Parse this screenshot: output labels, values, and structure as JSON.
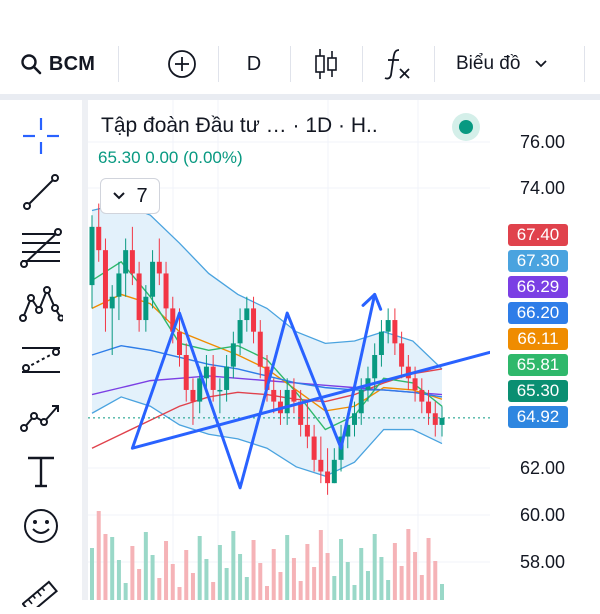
{
  "toolbar": {
    "symbol": "BCM",
    "interval": "D",
    "chart_type_label": "Biểu đồ"
  },
  "sidebar": {
    "tools": [
      "crosshair-icon",
      "trend-line-icon",
      "fib-retracement-icon",
      "pattern-icon",
      "forecast-icon",
      "brush-icon",
      "text-icon",
      "emoji-icon",
      "ruler-icon"
    ]
  },
  "legend": {
    "title": "Tập đoàn Đầu tư …  · 1D · H..",
    "price": "65.30",
    "change": "0.00",
    "change_pct": "(0.00%)",
    "indicator_count": "7"
  },
  "price_scale": {
    "ticks": [
      "76.00",
      "74.00",
      "62.00",
      "60.00",
      "58.00"
    ],
    "badges": [
      {
        "label": "67.40",
        "color": "#e0424c"
      },
      {
        "label": "67.30",
        "color": "#4aa3df"
      },
      {
        "label": "66.29",
        "color": "#7b3fe4"
      },
      {
        "label": "66.20",
        "color": "#2e7de8"
      },
      {
        "label": "66.11",
        "color": "#ef8c00"
      },
      {
        "label": "65.81",
        "color": "#2fb86b"
      },
      {
        "label": "65.30",
        "color": "#0a8f72"
      },
      {
        "label": "64.92",
        "color": "#2e86e0"
      }
    ]
  },
  "chart_data": {
    "type": "candlestick",
    "ylim": [
      57,
      78
    ],
    "candles": [
      [
        71,
        74,
        70,
        73.5
      ],
      [
        73.5,
        74.5,
        72,
        72.5
      ],
      [
        72.5,
        73,
        69,
        70
      ],
      [
        70,
        71,
        68,
        70.5
      ],
      [
        70.5,
        72,
        69.5,
        71.5
      ],
      [
        71.5,
        73,
        70.5,
        72.5
      ],
      [
        72.5,
        73.5,
        71,
        71.5
      ],
      [
        71.5,
        72,
        69,
        69.5
      ],
      [
        69.5,
        71,
        69,
        70.5
      ],
      [
        70.5,
        72.5,
        70,
        72
      ],
      [
        72,
        73,
        71,
        71.5
      ],
      [
        71.5,
        72,
        69.5,
        70
      ],
      [
        70,
        70.5,
        68.5,
        69
      ],
      [
        69,
        70,
        67.5,
        68
      ],
      [
        68,
        68.5,
        66,
        66.5
      ],
      [
        66.5,
        67,
        65,
        66
      ],
      [
        66,
        67.5,
        65.5,
        67
      ],
      [
        67,
        68,
        66.5,
        67.5
      ],
      [
        67.5,
        68,
        66,
        66.5
      ],
      [
        66.5,
        67,
        65.5,
        66.5
      ],
      [
        66.5,
        68,
        66,
        67.5
      ],
      [
        67.5,
        69,
        67,
        68.5
      ],
      [
        68.5,
        70,
        68,
        69.5
      ],
      [
        69.5,
        70.5,
        69,
        70
      ],
      [
        70,
        70.5,
        68.5,
        69
      ],
      [
        69,
        69.5,
        67,
        67.5
      ],
      [
        67.5,
        68,
        66,
        66.5
      ],
      [
        66.5,
        67,
        65.5,
        66
      ],
      [
        66,
        66.5,
        65,
        65.5
      ],
      [
        65.5,
        67,
        65,
        66.5
      ],
      [
        66.5,
        67,
        65.5,
        66
      ],
      [
        66,
        66.5,
        64.5,
        65
      ],
      [
        65,
        66,
        64,
        64.5
      ],
      [
        64.5,
        65,
        63,
        63.5
      ],
      [
        63.5,
        64.5,
        62.5,
        63
      ],
      [
        63,
        64,
        62,
        62.5
      ],
      [
        62.5,
        64,
        62.5,
        63.5
      ],
      [
        63.5,
        65,
        63,
        64.5
      ],
      [
        64.5,
        65.5,
        64,
        65
      ],
      [
        65,
        66,
        64.5,
        65.5
      ],
      [
        65.5,
        67,
        65,
        66.5
      ],
      [
        66.5,
        67.5,
        66,
        67
      ],
      [
        67,
        68.5,
        66.5,
        68
      ],
      [
        68,
        69.5,
        67.5,
        69
      ],
      [
        69,
        70,
        68.5,
        69.5
      ],
      [
        69.5,
        70,
        68,
        68.5
      ],
      [
        68.5,
        69,
        67,
        67.5
      ],
      [
        67.5,
        68,
        66.5,
        67
      ],
      [
        67,
        67.5,
        66,
        66.5
      ],
      [
        66.5,
        67,
        65.5,
        66
      ],
      [
        66,
        66.5,
        65,
        65.5
      ],
      [
        65.5,
        66,
        64.5,
        65
      ],
      [
        65,
        65.8,
        64.5,
        65.3
      ]
    ],
    "overlays": [
      {
        "name": "",
        "color": "#7b3fe4",
        "values": [
          66.3,
          66.6,
          66.9,
          67.0,
          67.1,
          67.0,
          66.9,
          66.8,
          66.7,
          66.6,
          66.5,
          66.4,
          66.3
        ]
      },
      {
        "name": "",
        "color": "#e0424c",
        "values": [
          64.0,
          64.6,
          65.2,
          65.8,
          66.2,
          66.4,
          66.3,
          66.1,
          66.0,
          66.3,
          66.8,
          67.2,
          67.4
        ]
      },
      {
        "name": "",
        "color": "#ef8c00",
        "values": [
          70.0,
          70.6,
          70.2,
          69.0,
          68.5,
          68.0,
          67.4,
          66.5,
          65.6,
          65.8,
          66.6,
          66.5,
          66.1
        ]
      },
      {
        "name": "",
        "color": "#2fb86b",
        "values": [
          71.2,
          72.0,
          70.5,
          68.5,
          68.2,
          68.4,
          67.8,
          66.4,
          64.8,
          65.4,
          67.0,
          66.8,
          65.8
        ]
      },
      {
        "name": "",
        "color": "#2e7de8",
        "values": [
          68.0,
          68.4,
          68.2,
          67.9,
          67.6,
          67.4,
          67.1,
          66.8,
          66.6,
          66.5,
          66.5,
          66.4,
          66.2
        ]
      }
    ],
    "bands": {
      "upper": [
        74.2,
        74.5,
        74.0,
        72.8,
        71.5,
        70.6,
        70.0,
        69.0,
        68.5,
        68.6,
        69.0,
        68.6,
        67.4
      ],
      "lower": [
        65.5,
        66.2,
        65.8,
        65.0,
        64.6,
        64.4,
        64.0,
        63.2,
        62.8,
        63.4,
        64.8,
        64.8,
        64.2
      ]
    },
    "trend_path": [
      [
        65.4,
        68.6
      ],
      [
        6,
        64.0
      ],
      [
        13,
        69.8
      ],
      [
        22,
        62.3
      ],
      [
        29,
        69.8
      ],
      [
        37,
        64.0
      ],
      [
        42,
        70.6
      ]
    ]
  }
}
